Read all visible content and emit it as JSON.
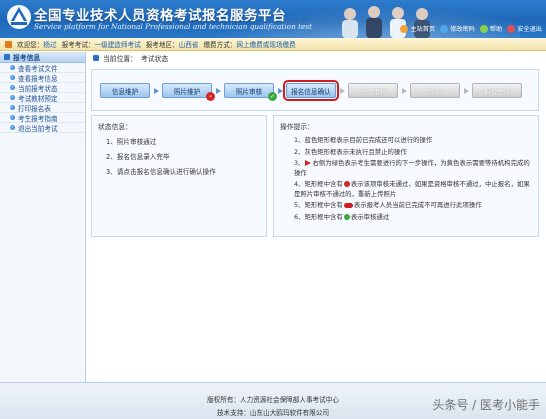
{
  "header": {
    "title_cn": "全国专业技术人员资格考试报名服务平台",
    "title_en": "Service platform for National Professional and technician qualification test",
    "links": [
      {
        "label": "主站首页",
        "color": "#f2a23a"
      },
      {
        "label": "修改密码",
        "color": "#4fa8e8"
      },
      {
        "label": "帮助",
        "color": "#8ccf4f"
      },
      {
        "label": "安全退出",
        "color": "#e05050"
      }
    ]
  },
  "infobar": {
    "welcome_label": "欢迎您：",
    "welcome_value": "杨过",
    "exam_label": "报考考试：",
    "exam_value": "一级建造师考试",
    "region_label": "报考地区：",
    "region_value": "山西省",
    "payment_label": "缴费方式：",
    "payment_value": "网上缴费或现场缴费"
  },
  "sidebar": {
    "title": "报考信息",
    "items": [
      {
        "label": "查看考试文件"
      },
      {
        "label": "查看报考信息"
      },
      {
        "label": "当前报考状态"
      },
      {
        "label": "考试教材预定"
      },
      {
        "label": "打印报名表"
      },
      {
        "label": "考生报考指南"
      },
      {
        "label": "退出当前考试"
      }
    ]
  },
  "crumb": {
    "label": "当前位置：",
    "value": "考试状态"
  },
  "steps": [
    {
      "label": "信息维护",
      "state": "done",
      "badge": ""
    },
    {
      "label": "照片维护",
      "state": "done",
      "badge": "fail"
    },
    {
      "label": "照片审核",
      "state": "done",
      "badge": "ok"
    },
    {
      "label": "报名信息确认",
      "state": "current",
      "badge": ""
    },
    {
      "label": "资格审核",
      "state": "todo",
      "badge": ""
    },
    {
      "label": "缴 费",
      "state": "todo",
      "badge": ""
    },
    {
      "label": "报名完成",
      "state": "todo",
      "badge": ""
    }
  ],
  "status": {
    "title": "状态信息：",
    "lines": [
      "1、照片审核通过",
      "2、报名信息录入完毕",
      "3、请点击报名信息确认进行确认操作"
    ]
  },
  "ops": {
    "title": "操作提示：",
    "l1": "1、蓝色矩形框表示目前已完成还可以进行的操作",
    "l2": "2、灰色矩形框表示未执行且禁止的操作",
    "l3_num": "3、",
    "l3_text": "右侧为绿色表示考生需要进行的下一步操作，为黄色表示需要等待机构完成的操作",
    "l4_pre": "4、矩形框中含有",
    "l4_post": "表示该项审核未通过，如果是资格审核不通过，中止报名，如果是照片审核不通过的，重新上传照片",
    "l5_pre": "5、矩形框中含有",
    "l5_post": "表示报考人员当前已完成不可再进行此项操作",
    "l6_pre": "6、矩形框中含有",
    "l6_post": "表示审核通过"
  },
  "footer": {
    "copyright": "版权所有：人力资源社会保障部人事考试中心",
    "support": "技术支持：山东山大鸥玛软件有限公司"
  },
  "watermark": "头条号 / 医考小能手"
}
